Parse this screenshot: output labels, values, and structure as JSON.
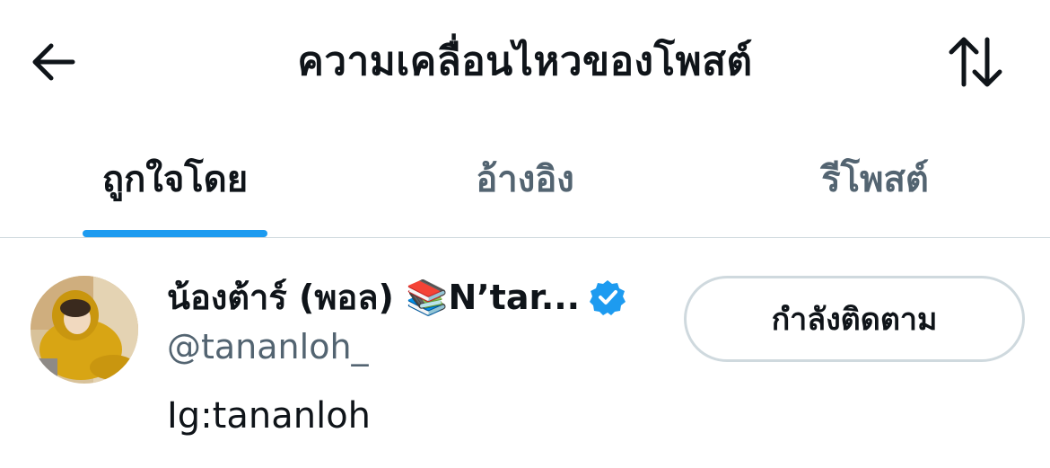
{
  "header": {
    "title": "ความเคลื่อนไหวของโพสต์",
    "back_icon": "arrow-left-icon",
    "sort_icon": "sort-arrows-icon"
  },
  "tabs": [
    {
      "label": "ถูกใจโดย",
      "active": true
    },
    {
      "label": "อ้างอิง",
      "active": false
    },
    {
      "label": "รีโพสต์",
      "active": false
    }
  ],
  "colors": {
    "accent": "#1d9bf0",
    "text_primary": "#0f1419",
    "text_secondary": "#536471",
    "border": "#cfd9de"
  },
  "users": [
    {
      "display_name": "น้องต้าร์ (พอล) 📚N’tar...",
      "handle": "@tananloh_",
      "bio": "Ig:tananloh",
      "verified": true,
      "follow_button": "กำลังติดตาม"
    }
  ]
}
